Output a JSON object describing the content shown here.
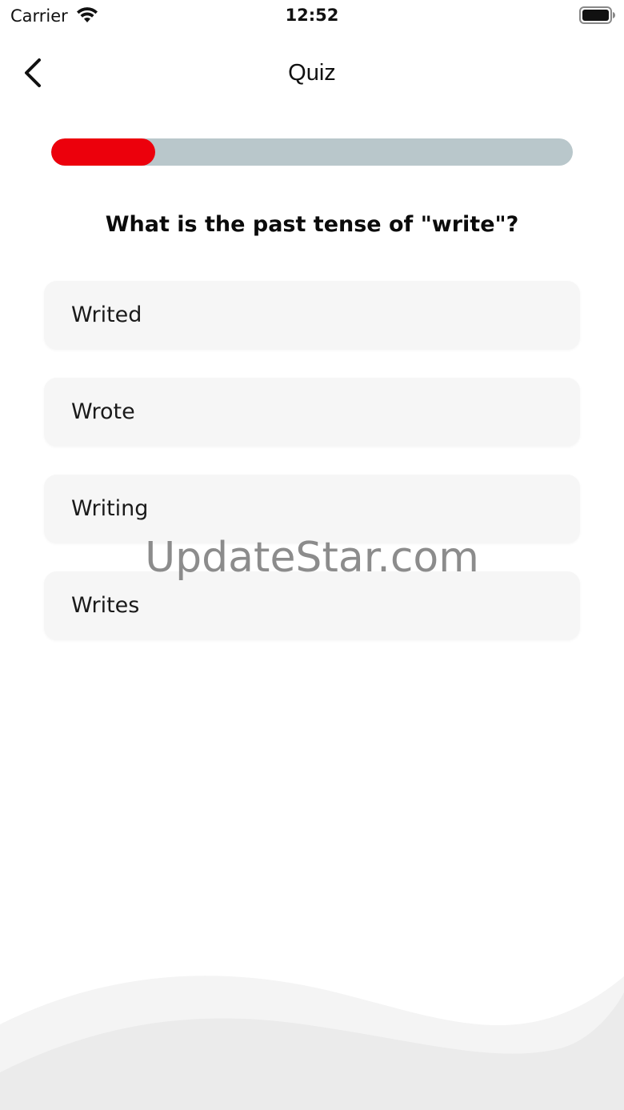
{
  "status_bar": {
    "carrier": "Carrier",
    "time": "12:52"
  },
  "nav": {
    "title": "Quiz"
  },
  "progress": {
    "fraction": 0.2,
    "fill_color": "#ec000c",
    "track_color": "#b9c7cb"
  },
  "question": {
    "text": "What is the past tense of \"write\"?"
  },
  "options": [
    {
      "label": "Writed"
    },
    {
      "label": "Wrote"
    },
    {
      "label": "Writing"
    },
    {
      "label": "Writes"
    }
  ],
  "watermark": "UpdateStar.com",
  "icons": {
    "back": "chevron-left-icon",
    "wifi": "wifi-icon",
    "battery": "battery-icon"
  }
}
